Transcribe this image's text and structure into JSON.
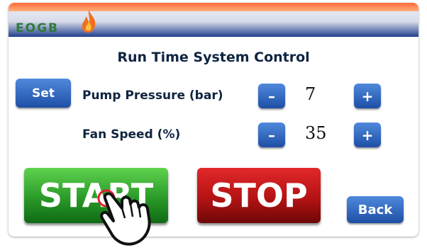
{
  "header": {
    "logo_text": "EOGB"
  },
  "title": "Run Time System Control",
  "controls": {
    "set_label": "Set",
    "pump": {
      "label": "Pump Pressure (bar)",
      "value": "7",
      "minus": "–",
      "plus": "+"
    },
    "fan": {
      "label": "Fan Speed (%)",
      "value": "35",
      "minus": "–",
      "plus": "+"
    }
  },
  "actions": {
    "start_label": "START",
    "stop_label": "STOP",
    "back_label": "Back"
  },
  "colors": {
    "start": "#2a9a28",
    "stop": "#b41314",
    "button_blue": "#2a5fb8",
    "accent_orange": "#ff6a3a"
  },
  "icons": [
    "flame-icon",
    "pointing-hand-icon",
    "touch-indicator-icon"
  ]
}
